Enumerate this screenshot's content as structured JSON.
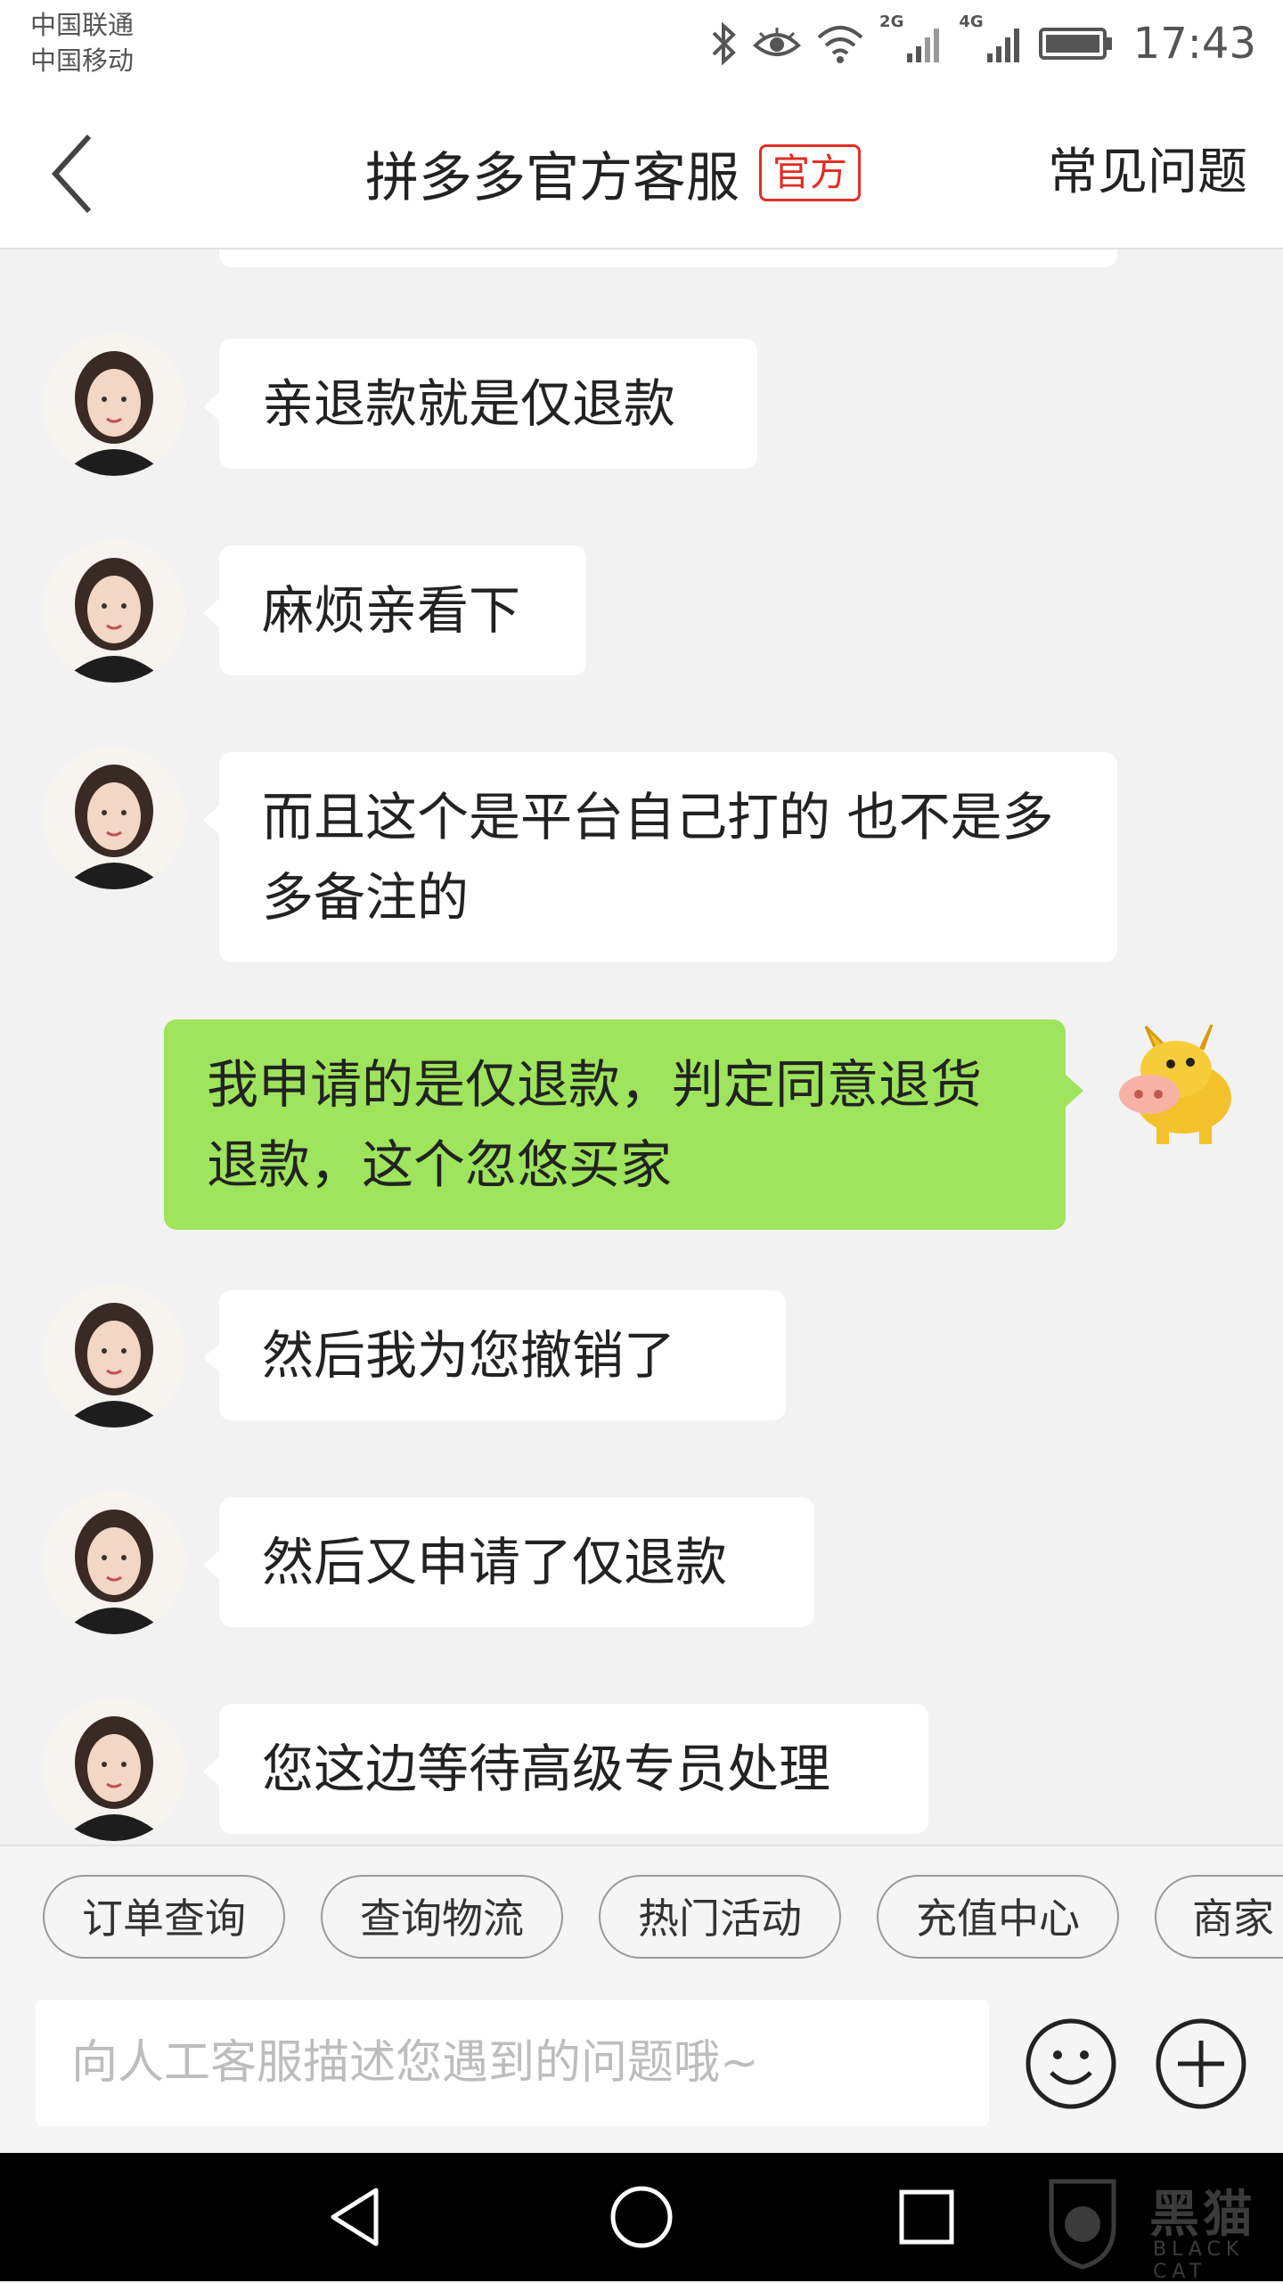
{
  "status_bar": {
    "carrier_1": "中国联通",
    "carrier_2": "中国移动",
    "network_1": "2G",
    "network_2": "4G",
    "time": "17:43",
    "icons": [
      "bluetooth-icon",
      "eye-icon",
      "wifi-icon",
      "signal-icon",
      "battery-icon"
    ]
  },
  "header": {
    "title": "拼多多官方客服",
    "badge": "官方",
    "faq": "常见问题",
    "accent_color": "#e02e24"
  },
  "messages": [
    {
      "side": "left",
      "text": "亲退款就是仅退款"
    },
    {
      "side": "left",
      "text": "麻烦亲看下"
    },
    {
      "side": "left",
      "text": "而且这个是平台自己打的 也不是多多备注的"
    },
    {
      "side": "right",
      "text": "我申请的是仅退款，判定同意退货退款，这个忽悠买家"
    },
    {
      "side": "left",
      "text": "然后我为您撤销了"
    },
    {
      "side": "left",
      "text": "然后又申请了仅退款"
    },
    {
      "side": "left",
      "text": "您这边等待高级专员处理"
    }
  ],
  "quick_chips": [
    "订单查询",
    "查询物流",
    "热门活动",
    "充值中心",
    "商家"
  ],
  "input": {
    "placeholder": "向人工客服描述您遇到的问题哦~",
    "value": ""
  },
  "colors": {
    "sent_bubble": "#9ee45c",
    "received_bubble": "#ffffff",
    "background": "#f2f2f2"
  },
  "watermark": {
    "text": "黑猫",
    "sub": "BLACK CAT"
  }
}
